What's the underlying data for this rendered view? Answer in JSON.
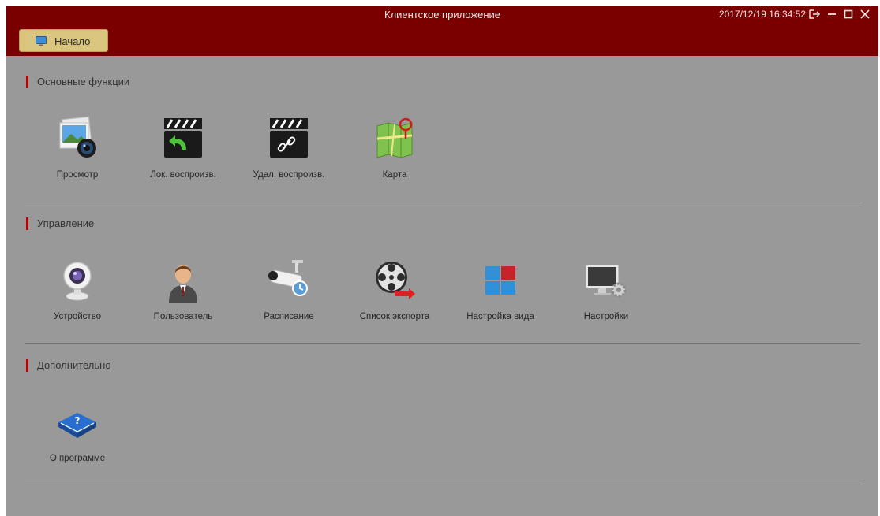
{
  "titlebar": {
    "title": "Клиентское приложение",
    "datetime": "2017/12/19 16:34:52",
    "controls": [
      "logout-icon",
      "minimize-icon",
      "maximize-icon",
      "close-icon"
    ]
  },
  "start_button": {
    "label": "Начало",
    "icon": "monitor-icon"
  },
  "sections": [
    {
      "title": "Основные функции",
      "items": [
        {
          "label": "Просмотр",
          "icon": "photo-camera-icon"
        },
        {
          "label": "Лок. воспроизв.",
          "icon": "clapper-replay-icon"
        },
        {
          "label": "Удал. воспроизв.",
          "icon": "clapper-link-icon"
        },
        {
          "label": "Карта",
          "icon": "map-pin-icon"
        }
      ]
    },
    {
      "title": "Управление",
      "items": [
        {
          "label": "Устройство",
          "icon": "webcam-icon"
        },
        {
          "label": "Пользователь",
          "icon": "user-icon"
        },
        {
          "label": "Расписание",
          "icon": "cctv-clock-icon"
        },
        {
          "label": "Список экспорта",
          "icon": "film-reel-export-icon"
        },
        {
          "label": "Настройка вида",
          "icon": "layout-grid-icon"
        },
        {
          "label": "Настройки",
          "icon": "monitor-gear-icon"
        }
      ]
    },
    {
      "title": "Дополнительно",
      "items": [
        {
          "label": "О программе",
          "icon": "help-book-icon"
        }
      ]
    }
  ],
  "colors": {
    "titlebar": "#7a0000",
    "background": "#999999",
    "accent": "#c00000",
    "start_button": "#d9c57e"
  }
}
